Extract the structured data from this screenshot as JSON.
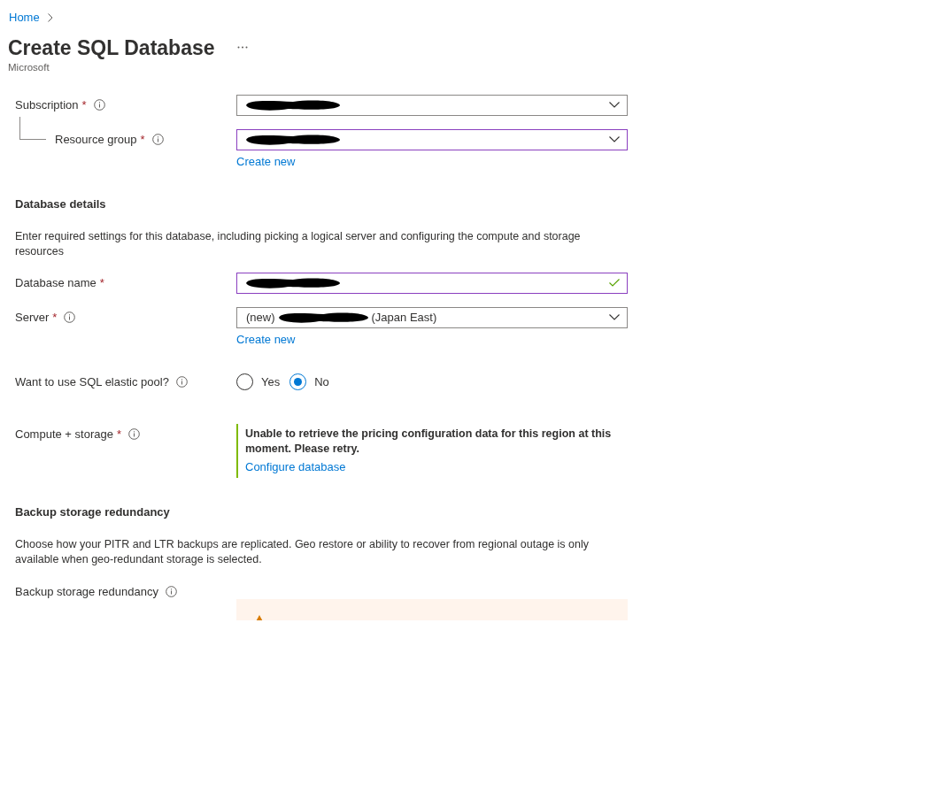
{
  "breadcrumb": [
    {
      "label": "Home"
    }
  ],
  "title": "Create SQL Database",
  "publisher": "Microsoft",
  "rows": [
    {
      "kind": "select",
      "label": "Subscription",
      "required_mark": "*",
      "info": true,
      "indented": false,
      "focused": false,
      "value_parts": [
        {
          "kind": "redacted"
        }
      ]
    },
    {
      "kind": "select",
      "label": "Resource group",
      "required_mark": "*",
      "info": true,
      "indented": true,
      "focused": true,
      "value_parts": [
        {
          "kind": "redacted"
        }
      ],
      "link": "Create new"
    },
    {
      "kind": "heading",
      "text": "Database details"
    },
    {
      "kind": "paragraph",
      "text": "Enter required settings for this database, including picking a logical server and configuring the compute and storage resources"
    },
    {
      "kind": "text",
      "label": "Database name",
      "required_mark": "*",
      "info": false,
      "indented": false,
      "focused": true,
      "valid": true,
      "value_parts": [
        {
          "kind": "redacted"
        }
      ]
    },
    {
      "kind": "select",
      "label": "Server",
      "required_mark": "*",
      "info": true,
      "indented": false,
      "focused": false,
      "value_parts": [
        {
          "kind": "text",
          "text": "(new)"
        },
        {
          "kind": "redacted"
        },
        {
          "kind": "text",
          "text": "(Japan East)"
        }
      ],
      "link": "Create new"
    },
    {
      "kind": "radio",
      "label": "Want to use SQL elastic pool?",
      "info": true,
      "options": [
        {
          "label": "Yes",
          "selected": false
        },
        {
          "label": "No",
          "selected": true
        }
      ]
    },
    {
      "kind": "message",
      "label": "Compute + storage",
      "required_mark": "*",
      "info": true,
      "message": "Unable to retrieve the pricing configuration data for this region at this moment. Please retry.",
      "link": "Configure database"
    },
    {
      "kind": "heading",
      "text": "Backup storage redundancy"
    },
    {
      "kind": "paragraph",
      "text": "Choose how your PITR and LTR backups are replicated. Geo restore or ability to recover from regional outage is only available when geo-redundant storage is selected."
    },
    {
      "kind": "warning",
      "label": "Backup storage redundancy",
      "info": true
    }
  ]
}
